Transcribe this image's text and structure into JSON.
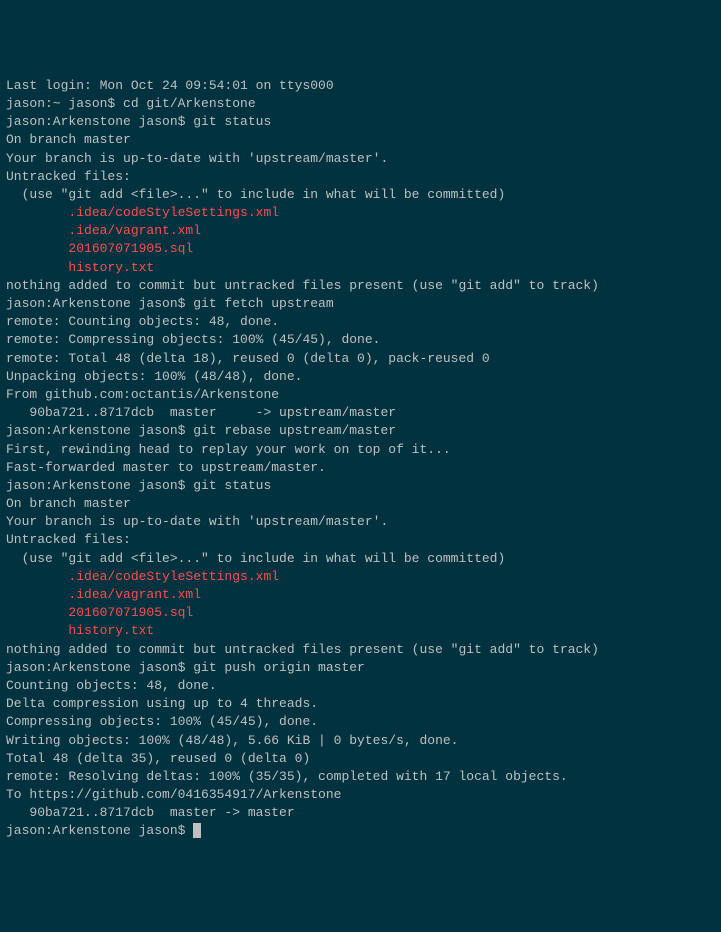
{
  "lines": [
    {
      "text": "Last login: Mon Oct 24 09:54:01 on ttys000"
    },
    {
      "text": "jason:~ jason$ cd git/Arkenstone"
    },
    {
      "text": "jason:Arkenstone jason$ git status"
    },
    {
      "text": "On branch master"
    },
    {
      "text": "Your branch is up-to-date with 'upstream/master'."
    },
    {
      "text": "Untracked files:"
    },
    {
      "text": "  (use \"git add <file>...\" to include in what will be committed)"
    },
    {
      "text": ""
    },
    {
      "text": "        .idea/codeStyleSettings.xml",
      "class": "red"
    },
    {
      "text": "        .idea/vagrant.xml",
      "class": "red"
    },
    {
      "text": "        201607071905.sql",
      "class": "red"
    },
    {
      "text": "        history.txt",
      "class": "red"
    },
    {
      "text": ""
    },
    {
      "text": "nothing added to commit but untracked files present (use \"git add\" to track)"
    },
    {
      "text": "jason:Arkenstone jason$ git fetch upstream"
    },
    {
      "text": "remote: Counting objects: 48, done."
    },
    {
      "text": "remote: Compressing objects: 100% (45/45), done."
    },
    {
      "text": "remote: Total 48 (delta 18), reused 0 (delta 0), pack-reused 0"
    },
    {
      "text": "Unpacking objects: 100% (48/48), done."
    },
    {
      "text": "From github.com:octantis/Arkenstone"
    },
    {
      "text": "   90ba721..8717dcb  master     -> upstream/master"
    },
    {
      "text": "jason:Arkenstone jason$ git rebase upstream/master"
    },
    {
      "text": "First, rewinding head to replay your work on top of it..."
    },
    {
      "text": "Fast-forwarded master to upstream/master."
    },
    {
      "text": "jason:Arkenstone jason$ git status"
    },
    {
      "text": "On branch master"
    },
    {
      "text": "Your branch is up-to-date with 'upstream/master'."
    },
    {
      "text": "Untracked files:"
    },
    {
      "text": "  (use \"git add <file>...\" to include in what will be committed)"
    },
    {
      "text": ""
    },
    {
      "text": "        .idea/codeStyleSettings.xml",
      "class": "red"
    },
    {
      "text": "        .idea/vagrant.xml",
      "class": "red"
    },
    {
      "text": "        201607071905.sql",
      "class": "red"
    },
    {
      "text": "        history.txt",
      "class": "red"
    },
    {
      "text": ""
    },
    {
      "text": "nothing added to commit but untracked files present (use \"git add\" to track)"
    },
    {
      "text": "jason:Arkenstone jason$ git push origin master"
    },
    {
      "text": "Counting objects: 48, done."
    },
    {
      "text": "Delta compression using up to 4 threads."
    },
    {
      "text": "Compressing objects: 100% (45/45), done."
    },
    {
      "text": "Writing objects: 100% (48/48), 5.66 KiB | 0 bytes/s, done."
    },
    {
      "text": "Total 48 (delta 35), reused 0 (delta 0)"
    },
    {
      "text": "remote: Resolving deltas: 100% (35/35), completed with 17 local objects."
    },
    {
      "text": "To https://github.com/0416354917/Arkenstone"
    },
    {
      "text": "   90ba721..8717dcb  master -> master"
    },
    {
      "text": "jason:Arkenstone jason$ ",
      "cursor": true
    }
  ]
}
